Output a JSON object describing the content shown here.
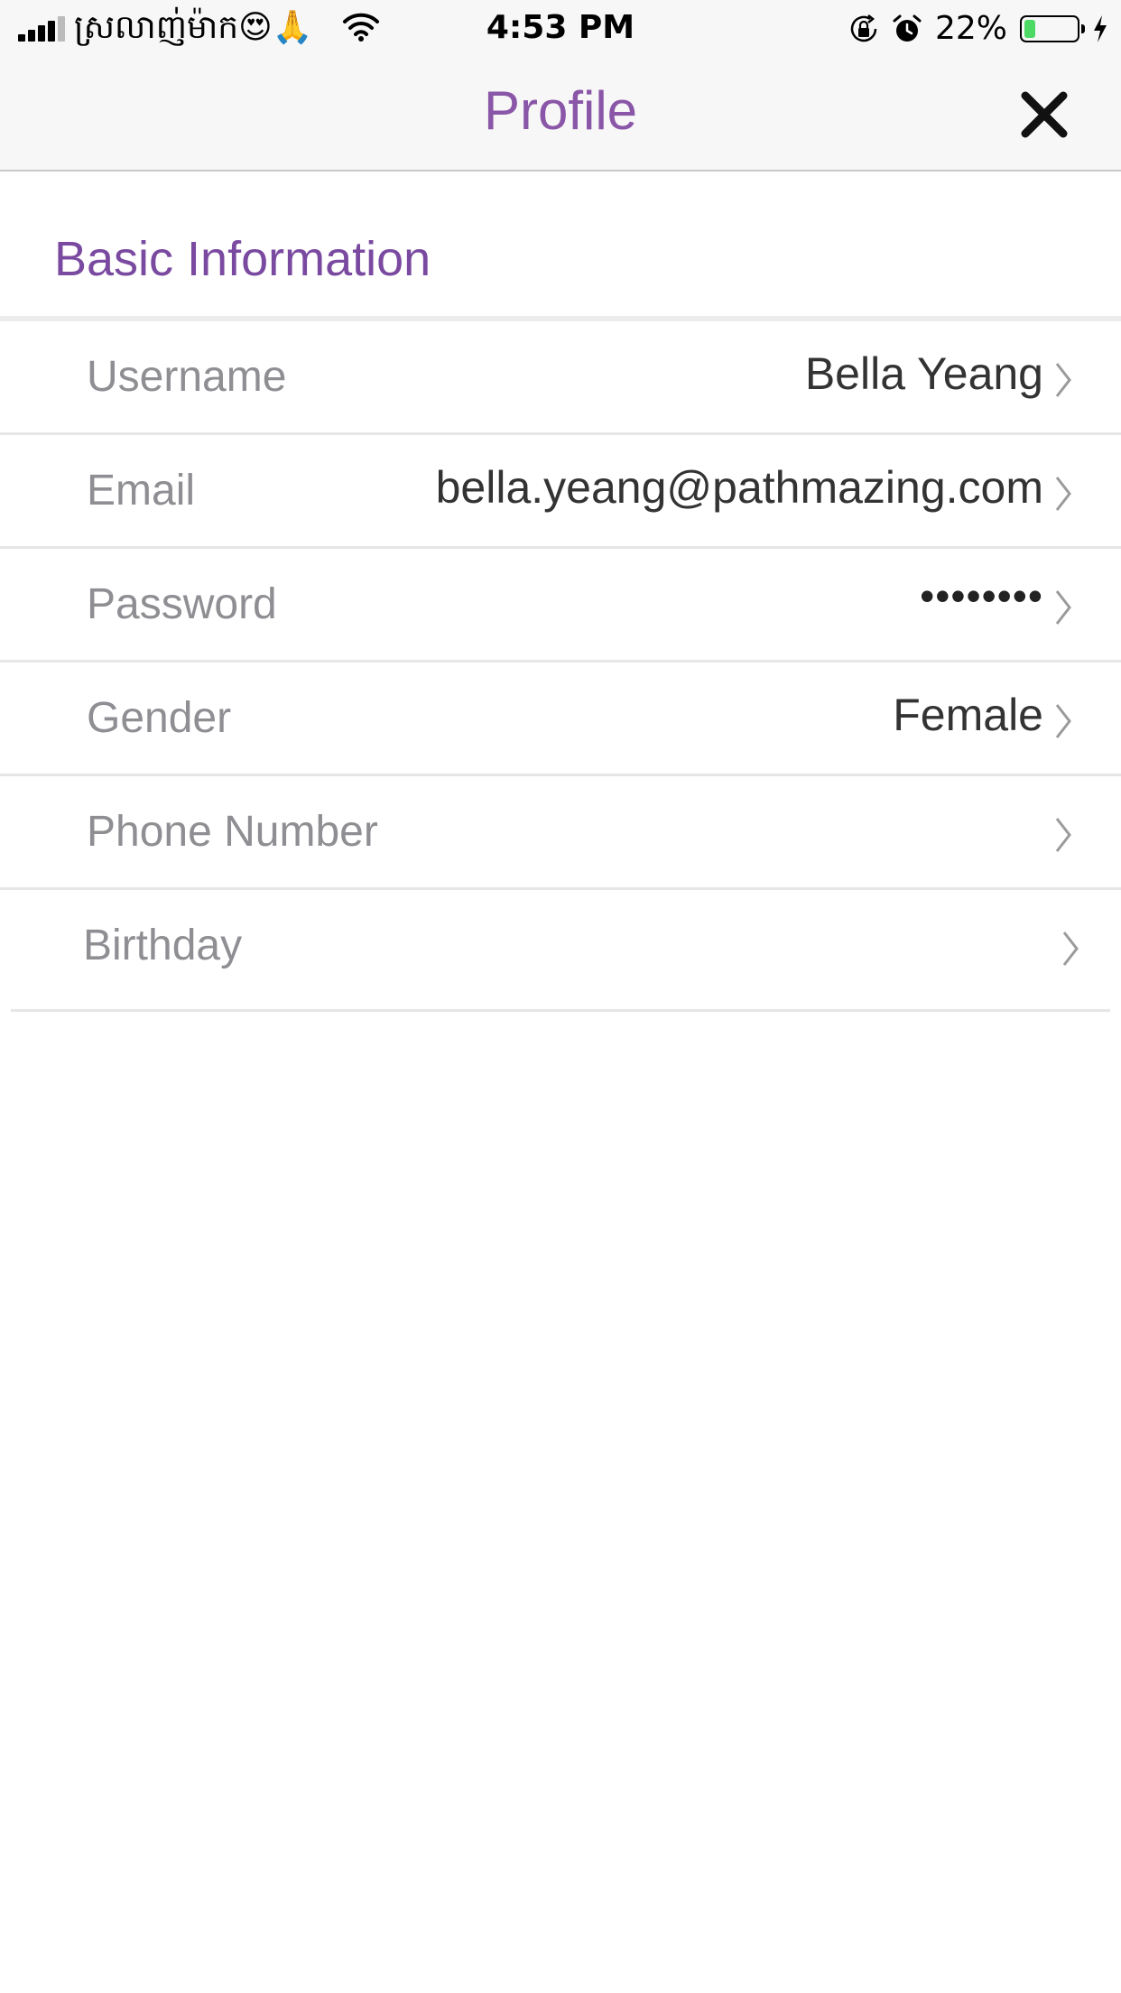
{
  "status_bar": {
    "carrier": "ស្រលាញ់ម៉ាក😍🙏",
    "time": "4:53 PM",
    "battery_percent": "22%",
    "battery_level": 0.22,
    "icons": [
      "signal-icon",
      "wifi-icon",
      "orientation-lock-icon",
      "alarm-icon",
      "battery-icon",
      "charging-icon"
    ]
  },
  "navbar": {
    "title": "Profile",
    "close_icon": "close-icon"
  },
  "section": {
    "title": "Basic Information"
  },
  "rows": [
    {
      "label": "Username",
      "value": "Bella Yeang"
    },
    {
      "label": "Email",
      "value": "bella.yeang@pathmazing.com"
    },
    {
      "label": "Password",
      "value": "••••••••"
    },
    {
      "label": "Gender",
      "value": "Female"
    },
    {
      "label": "Phone Number",
      "value": ""
    },
    {
      "label": "Birthday",
      "value": ""
    }
  ],
  "colors": {
    "accent": "#8a56a8",
    "section_header": "#7a4aa0",
    "label": "#8e8e93",
    "value": "#333333",
    "battery_fill": "#4cd964"
  }
}
